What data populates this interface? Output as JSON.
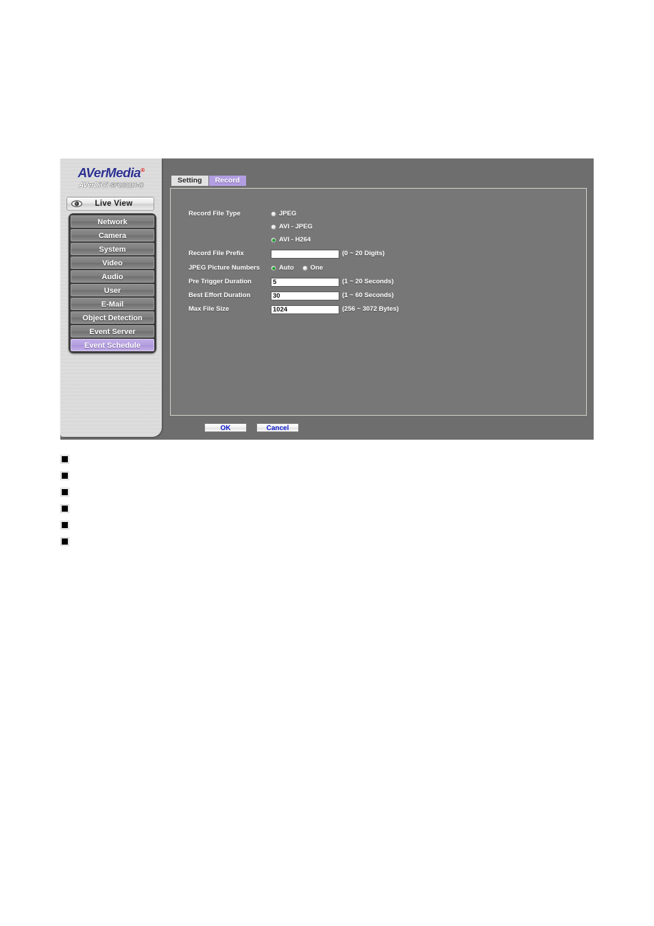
{
  "device_ui": {
    "logo": {
      "brand": "AVerMedia",
      "trademark": "®",
      "product_line": "AVerDiGi",
      "model": "SF1311H-D"
    },
    "live_view": {
      "label": "Live View",
      "icon": "eye-icon"
    },
    "nav_items": [
      {
        "label": "Network",
        "active": false
      },
      {
        "label": "Camera",
        "active": false
      },
      {
        "label": "System",
        "active": false
      },
      {
        "label": "Video",
        "active": false
      },
      {
        "label": "Audio",
        "active": false
      },
      {
        "label": "User",
        "active": false
      },
      {
        "label": "E-Mail",
        "active": false
      },
      {
        "label": "Object Detection",
        "active": false
      },
      {
        "label": "Event Server",
        "active": false
      },
      {
        "label": "Event Schedule",
        "active": true
      }
    ],
    "tabs": [
      {
        "label": "Setting",
        "active": false
      },
      {
        "label": "Record",
        "active": true
      }
    ],
    "form": {
      "record_file_type": {
        "label": "Record File Type",
        "options": [
          {
            "label": "JPEG",
            "selected": false
          },
          {
            "label": "AVI - JPEG",
            "selected": false
          },
          {
            "label": "AVI - H264",
            "selected": true
          }
        ]
      },
      "record_file_prefix": {
        "label": "Record File Prefix",
        "value": "",
        "hint": "(0 ~ 20 Digits)"
      },
      "jpeg_picture_numbers": {
        "label": "JPEG Picture Numbers",
        "options": [
          {
            "label": "Auto",
            "selected": true
          },
          {
            "label": "One",
            "selected": false
          }
        ]
      },
      "pre_trigger_duration": {
        "label": "Pre Trigger Duration",
        "value": "5",
        "hint": "(1 ~ 20 Seconds)"
      },
      "best_effort_duration": {
        "label": "Best Effort Duration",
        "value": "30",
        "hint": "(1 ~ 60 Seconds)"
      },
      "max_file_size": {
        "label": "Max File Size",
        "value": "1024",
        "hint": "(256 ~ 3072 Bytes)"
      }
    },
    "actions": {
      "ok_label": "OK",
      "cancel_label": "Cancel"
    },
    "colors": {
      "accent_purple": "#b39ee2",
      "panel_gray": "#6e6e6e",
      "form_gray": "#777777",
      "button_text_blue": "#0b18c8",
      "radio_selected_green": "#0e9b1e"
    }
  },
  "bullet_list": {
    "items": [
      {
        "text": ""
      },
      {
        "text": ""
      },
      {
        "text": ""
      },
      {
        "text": ""
      },
      {
        "text": ""
      },
      {
        "text": ""
      }
    ]
  }
}
